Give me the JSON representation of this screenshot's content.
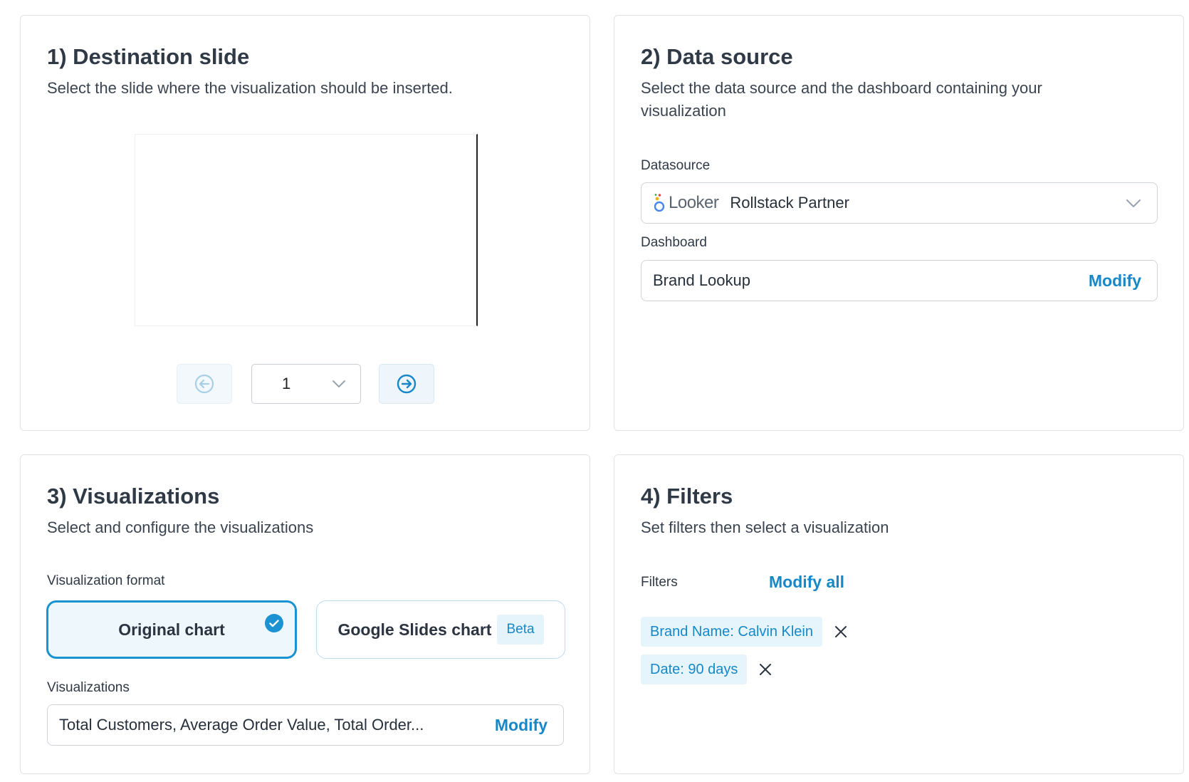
{
  "destination": {
    "title": "1) Destination slide",
    "subtitle": "Select the slide where the visualization should be inserted.",
    "page_value": "1",
    "prev_icon": "arrow-left-circle-icon",
    "next_icon": "arrow-right-circle-icon"
  },
  "datasource": {
    "title": "2) Data source",
    "subtitle": "Select the data source and the dashboard containing your visualization",
    "datasource_label": "Datasource",
    "provider_logo": "Looker",
    "datasource_value": "Rollstack Partner",
    "dashboard_label": "Dashboard",
    "dashboard_value": "Brand Lookup",
    "modify_label": "Modify"
  },
  "visualizations": {
    "title": "3) Visualizations",
    "subtitle": "Select and configure the visualizations",
    "format_label": "Visualization format",
    "format_original": "Original chart",
    "format_google": "Google Slides chart",
    "beta_badge": "Beta",
    "selected_format": "Original chart",
    "list_label": "Visualizations",
    "list_value": "Total Customers, Average Order Value, Total Order...",
    "modify_label": "Modify"
  },
  "filters": {
    "title": "4) Filters",
    "subtitle": "Set filters then select a visualization",
    "label": "Filters",
    "modify_all_label": "Modify all",
    "chips": [
      {
        "label": "Brand Name: Calvin Klein"
      },
      {
        "label": "Date: 90 days"
      }
    ]
  },
  "colors": {
    "accent": "#1688c8",
    "accent_bg": "#e6f4fb",
    "border": "#dfe3e8",
    "text": "#2b3440"
  }
}
